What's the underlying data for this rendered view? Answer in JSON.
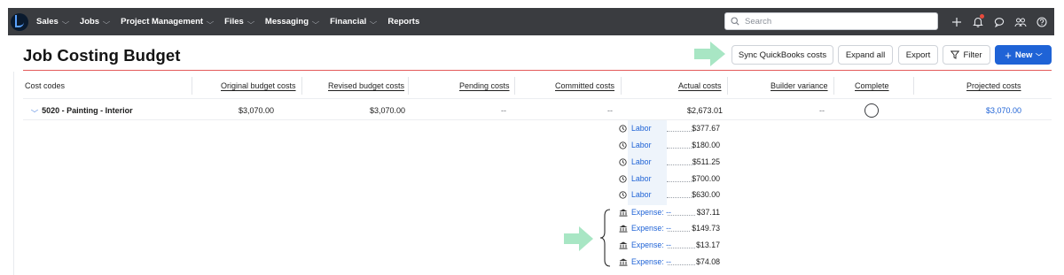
{
  "nav": {
    "items": [
      {
        "label": "Sales",
        "chevron": true
      },
      {
        "label": "Jobs",
        "chevron": true
      },
      {
        "label": "Project Management",
        "chevron": true
      },
      {
        "label": "Files",
        "chevron": true
      },
      {
        "label": "Messaging",
        "chevron": true
      },
      {
        "label": "Financial",
        "chevron": true
      },
      {
        "label": "Reports",
        "chevron": false
      }
    ],
    "search_placeholder": "Search",
    "icons": [
      "plus-icon",
      "bell-icon",
      "chat-icon",
      "people-icon",
      "help-icon"
    ]
  },
  "header": {
    "title": "Job Costing Budget",
    "buttons": {
      "sync": "Sync QuickBooks costs",
      "expand": "Expand all",
      "export": "Export",
      "filter": "Filter",
      "new": "New"
    }
  },
  "table": {
    "columns": {
      "cost_codes": "Cost codes",
      "original": "Original budget costs",
      "revised": "Revised budget costs",
      "pending": "Pending costs",
      "committed": "Committed costs",
      "actual": "Actual costs",
      "variance": "Builder variance",
      "complete": "Complete",
      "projected": "Projected costs"
    },
    "row": {
      "name": "5020 - Painting - Interior",
      "original": "$3,070.00",
      "revised": "$3,070.00",
      "pending": "--",
      "committed": "--",
      "actual": "$2,673.01",
      "variance": "--",
      "projected": "$3,070.00"
    },
    "breakdown": [
      {
        "type": "labor",
        "label": "Labor",
        "amount": "$377.67"
      },
      {
        "type": "labor",
        "label": "Labor",
        "amount": "$180.00"
      },
      {
        "type": "labor",
        "label": "Labor",
        "amount": "$511.25"
      },
      {
        "type": "labor",
        "label": "Labor",
        "amount": "$700.00"
      },
      {
        "type": "labor",
        "label": "Labor",
        "amount": "$630.00"
      },
      {
        "type": "expense",
        "label": "Expense: --",
        "amount": "$37.11"
      },
      {
        "type": "expense",
        "label": "Expense: --",
        "amount": "$149.73"
      },
      {
        "type": "expense",
        "label": "Expense: --",
        "amount": "$13.17"
      },
      {
        "type": "expense",
        "label": "Expense: --",
        "amount": "$74.08"
      }
    ]
  },
  "colors": {
    "nav_bg": "#3a3c40",
    "primary": "#1f63d6",
    "callout_arrow": "#a8e6c4",
    "title_rule": "#e45a5a"
  }
}
